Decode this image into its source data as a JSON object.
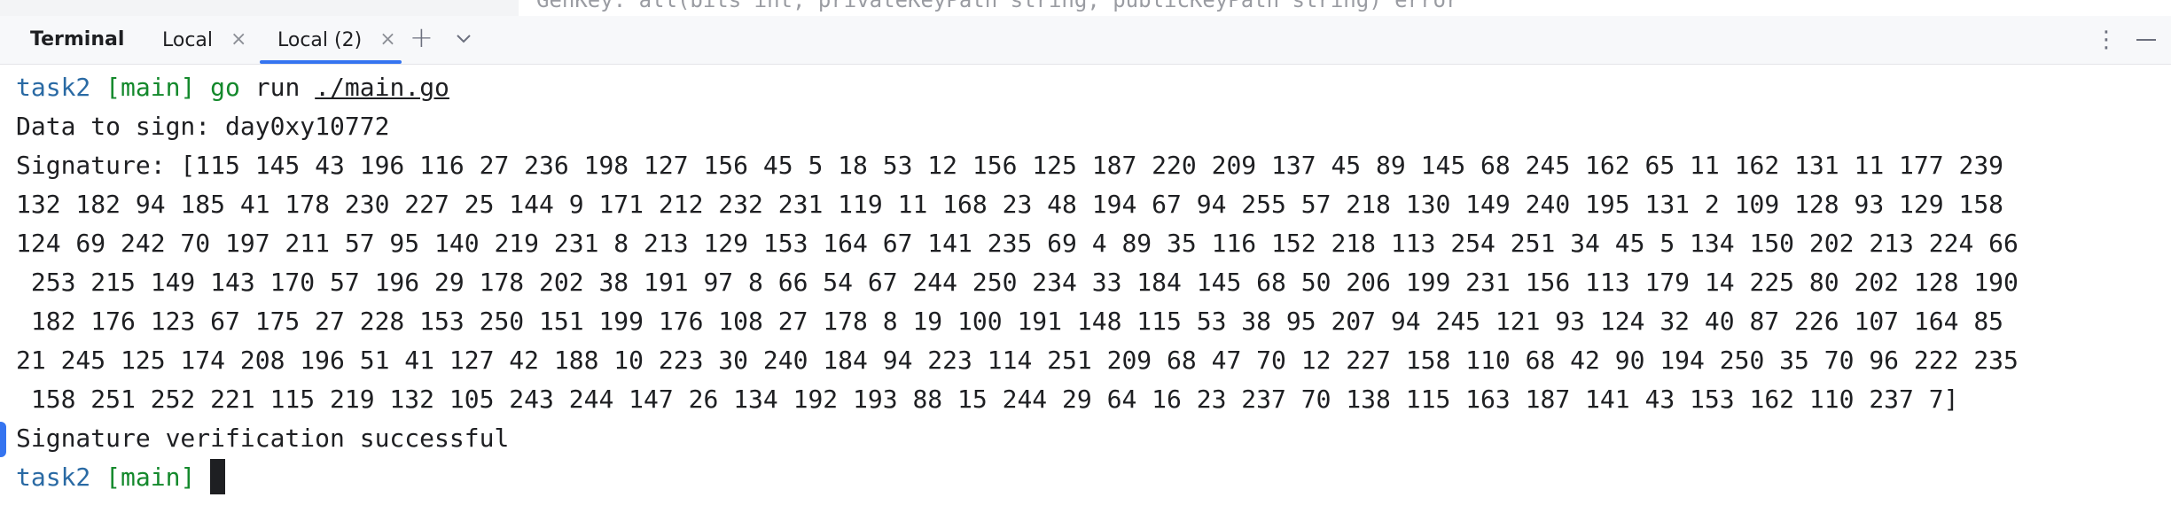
{
  "editor_hint": "GenKey: all(bits int, privateKeyPath string, publicKeyPath string) error",
  "tabs": {
    "title": "Terminal",
    "items": [
      {
        "label": "Local",
        "close": "×"
      },
      {
        "label": "Local (2)",
        "close": "×",
        "active": true
      }
    ],
    "add_symbol": "+",
    "more_symbol": "⋮"
  },
  "terminal": {
    "prompt_dir": "task2",
    "prompt_branch": "[main]",
    "command_go": "go",
    "command_run": "run",
    "command_arg": "./main.go",
    "output": [
      "Data to sign: day0xy10772",
      "Signature: [115 145 43 196 116 27 236 198 127 156 45 5 18 53 12 156 125 187 220 209 137 45 89 145 68 245 162 65 11 162 131 11 177 239",
      "132 182 94 185 41 178 230 227 25 144 9 171 212 232 231 119 11 168 23 48 194 67 94 255 57 218 130 149 240 195 131 2 109 128 93 129 158",
      "124 69 242 70 197 211 57 95 140 219 231 8 213 129 153 164 67 141 235 69 4 89 35 116 152 218 113 254 251 34 45 5 134 150 202 213 224 66",
      " 253 215 149 143 170 57 196 29 178 202 38 191 97 8 66 54 67 244 250 234 33 184 145 68 50 206 199 231 156 113 179 14 225 80 202 128 190",
      " 182 176 123 67 175 27 228 153 250 151 199 176 108 27 178 8 19 100 191 148 115 53 38 95 207 94 245 121 93 124 32 40 87 226 107 164 85",
      "21 245 125 174 208 196 51 41 127 42 188 10 223 30 240 184 94 223 114 251 209 68 47 70 12 227 158 110 68 42 90 194 250 35 70 96 222 235",
      " 158 251 252 221 115 219 132 105 243 244 147 26 134 192 193 88 15 244 29 64 16 23 237 70 138 115 163 187 141 43 153 162 110 237 7]",
      "Signature verification successful"
    ]
  },
  "colors": {
    "accent": "#3574f0",
    "prompt_dir": "#2a6aa4",
    "prompt_branch": "#14892c"
  }
}
